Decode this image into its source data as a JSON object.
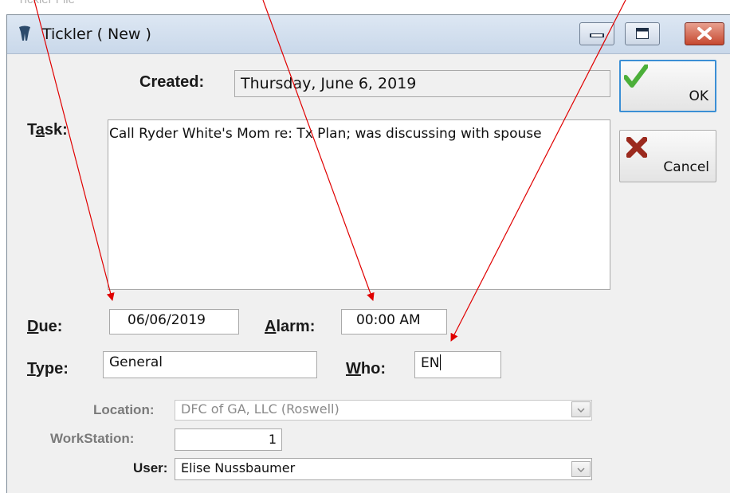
{
  "background_title": "Tickler File",
  "window": {
    "title": "Tickler ( New )",
    "minimize_icon": "minimize-icon",
    "maximize_icon": "maximize-icon",
    "close_icon": "close-icon",
    "app_icon": "tooth-icon"
  },
  "form": {
    "created_label": "Created:",
    "created_value": "Thursday, June 6, 2019",
    "task_label_pre": "T",
    "task_label_u": "a",
    "task_label_post": "sk:",
    "task_value": "Call Ryder White's Mom re: Tx Plan; was discussing with spouse",
    "due_label_u": "D",
    "due_label_post": "ue:",
    "due_value": "06/06/2019",
    "alarm_label_u": "A",
    "alarm_label_post": "larm:",
    "alarm_value": "00:00 AM",
    "type_label_u": "T",
    "type_label_post": "ype:",
    "type_value": "General",
    "who_label_u": "W",
    "who_label_post": "ho:",
    "who_value": "EN",
    "location_label": "Location:",
    "location_value": "DFC of GA, LLC (Roswell)",
    "workstation_label": "WorkStation:",
    "workstation_value": "1",
    "user_label": "User:",
    "user_value": "Elise Nussbaumer"
  },
  "buttons": {
    "ok_label": "OK",
    "ok_icon": "checkmark-icon",
    "cancel_label": "Cancel",
    "cancel_icon": "x-mark-icon"
  },
  "colors": {
    "ok_border": "#3b8fd5",
    "checkmark": "#4caf3a",
    "cancel_x": "#9b2a1e",
    "annotation_arrow": "#e00000"
  }
}
